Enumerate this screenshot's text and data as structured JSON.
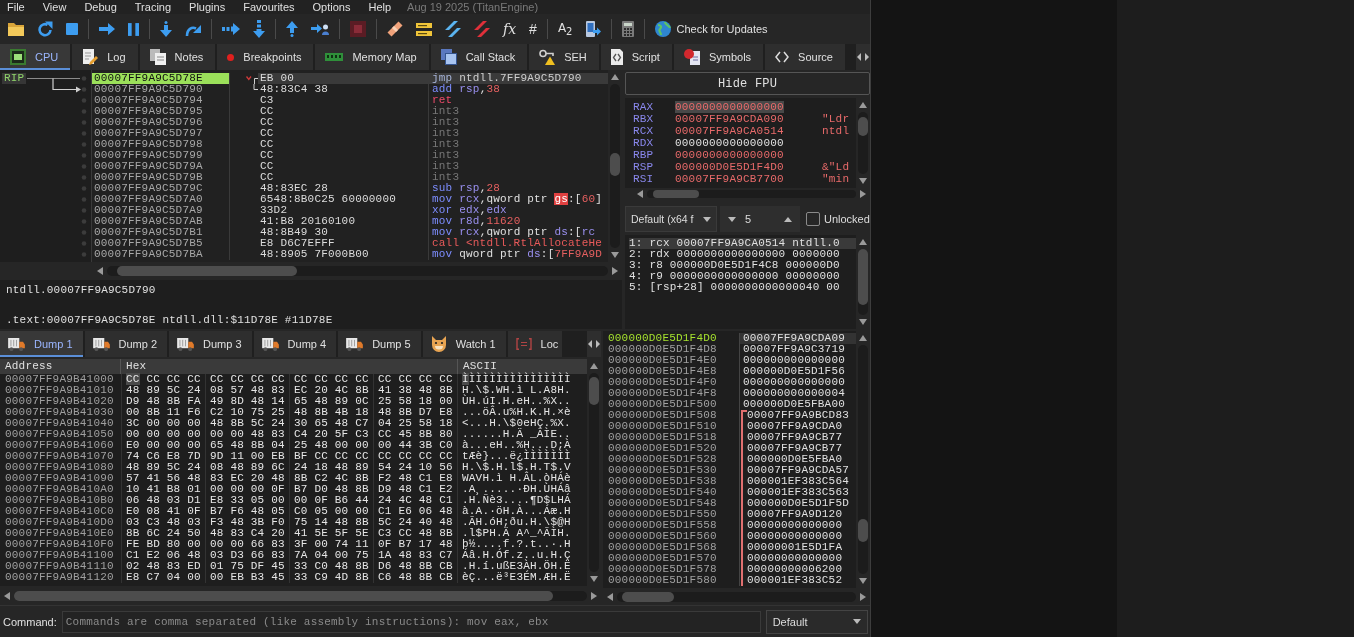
{
  "menu": [
    "File",
    "View",
    "Debug",
    "Tracing",
    "Plugins",
    "Favourites",
    "Options",
    "Help"
  ],
  "build_info": "Aug 19 2025 (TitanEngine)",
  "toolbar": {
    "glyphs": [
      "fx",
      "#",
      "A$_{2}$"
    ],
    "update_button": "Check for Updates"
  },
  "tabs": [
    {
      "label": "CPU",
      "selected": true
    },
    {
      "label": "Log",
      "selected": false
    },
    {
      "label": "Notes",
      "selected": false
    },
    {
      "label": "Breakpoints",
      "selected": false
    },
    {
      "label": "Memory Map",
      "selected": false
    },
    {
      "label": "Call Stack",
      "selected": false
    },
    {
      "label": "SEH",
      "selected": false
    },
    {
      "label": "Script",
      "selected": false
    },
    {
      "label": "Symbols",
      "selected": false
    },
    {
      "label": "Source",
      "selected": false
    }
  ],
  "disassembly": {
    "rip_label": "RIP",
    "rows": [
      {
        "address": "00007FF9A9C5D78E",
        "bytes": "EB 00",
        "mnemonic": "jmp",
        "kind": "jump",
        "operands": [
          {
            "text": "ntdll.7FF9A9C5D790",
            "kind": "symbol"
          }
        ],
        "selected": true,
        "jump_target": false
      },
      {
        "address": "00007FF9A9C5D790",
        "bytes": "48:83C4 38",
        "mnemonic": "add",
        "kind": "arith",
        "operands": [
          {
            "text": "rsp",
            "kind": "register"
          },
          {
            "text": ",",
            "kind": "plain"
          },
          {
            "text": "38",
            "kind": "number"
          }
        ],
        "selected": false,
        "jump_target": true
      },
      {
        "address": "00007FF9A9C5D794",
        "bytes": "C3",
        "mnemonic": "ret",
        "kind": "return",
        "selected": false,
        "jump_target": false
      },
      {
        "address": "00007FF9A9C5D795",
        "bytes": "CC",
        "mnemonic": "int3",
        "kind": "padding",
        "selected": false,
        "jump_target": false
      },
      {
        "address": "00007FF9A9C5D796",
        "bytes": "CC",
        "mnemonic": "int3",
        "kind": "padding",
        "selected": false,
        "jump_target": false
      },
      {
        "address": "00007FF9A9C5D797",
        "bytes": "CC",
        "mnemonic": "int3",
        "kind": "padding",
        "selected": false,
        "jump_target": false
      },
      {
        "address": "00007FF9A9C5D798",
        "bytes": "CC",
        "mnemonic": "int3",
        "kind": "padding",
        "selected": false,
        "jump_target": false
      },
      {
        "address": "00007FF9A9C5D799",
        "bytes": "CC",
        "mnemonic": "int3",
        "kind": "padding",
        "selected": false,
        "jump_target": false
      },
      {
        "address": "00007FF9A9C5D79A",
        "bytes": "CC",
        "mnemonic": "int3",
        "kind": "padding",
        "selected": false,
        "jump_target": false
      },
      {
        "address": "00007FF9A9C5D79B",
        "bytes": "CC",
        "mnemonic": "int3",
        "kind": "padding",
        "selected": false,
        "jump_target": false
      },
      {
        "address": "00007FF9A9C5D79C",
        "bytes": "48:83EC 28",
        "mnemonic": "sub",
        "kind": "arith",
        "operands": [
          {
            "text": "rsp",
            "kind": "register"
          },
          {
            "text": ",",
            "kind": "plain"
          },
          {
            "text": "28",
            "kind": "number"
          }
        ],
        "selected": false,
        "jump_target": false
      },
      {
        "address": "00007FF9A9C5D7A0",
        "bytes": "6548:8B0C25 60000000",
        "mnemonic": "mov",
        "kind": "arith",
        "operands": [
          {
            "text": "rcx",
            "kind": "register"
          },
          {
            "text": ",qword ptr ",
            "kind": "plain"
          },
          {
            "text": "gs",
            "kind": "segment_alert"
          },
          {
            "text": ":[",
            "kind": "plain"
          },
          {
            "text": "60",
            "kind": "number"
          },
          {
            "text": "]",
            "kind": "plain"
          }
        ],
        "selected": false,
        "jump_target": false
      },
      {
        "address": "00007FF9A9C5D7A9",
        "bytes": "33D2",
        "mnemonic": "xor",
        "kind": "arith",
        "operands": [
          {
            "text": "edx",
            "kind": "register"
          },
          {
            "text": ",",
            "kind": "plain"
          },
          {
            "text": "edx",
            "kind": "register"
          }
        ],
        "selected": false,
        "jump_target": false
      },
      {
        "address": "00007FF9A9C5D7AB",
        "bytes": "41:B8 20160100",
        "mnemonic": "mov",
        "kind": "arith",
        "operands": [
          {
            "text": "r8d",
            "kind": "register"
          },
          {
            "text": ",",
            "kind": "plain"
          },
          {
            "text": "11620",
            "kind": "number"
          }
        ],
        "selected": false,
        "jump_target": false
      },
      {
        "address": "00007FF9A9C5D7B1",
        "bytes": "48:8B49 30",
        "mnemonic": "mov",
        "kind": "arith",
        "operands": [
          {
            "text": "rcx",
            "kind": "register"
          },
          {
            "text": ",qword ptr ",
            "kind": "plain"
          },
          {
            "text": "ds",
            "kind": "segment"
          },
          {
            "text": ":[",
            "kind": "plain"
          },
          {
            "text": "rc",
            "kind": "register"
          }
        ],
        "selected": false,
        "jump_target": false
      },
      {
        "address": "00007FF9A9C5D7B5",
        "bytes": "E8 D6C7EFFF",
        "mnemonic": "call",
        "kind": "call",
        "operands": [
          {
            "text": "<ntdll.RtlAllocateHe",
            "kind": "call_target"
          }
        ],
        "selected": false,
        "jump_target": false
      },
      {
        "address": "00007FF9A9C5D7BA",
        "bytes": "48:8905 7F000B00",
        "mnemonic": "mov",
        "kind": "arith",
        "operands": [
          {
            "text": "qword ptr ",
            "kind": "plain"
          },
          {
            "text": "ds",
            "kind": "segment"
          },
          {
            "text": ":[",
            "kind": "plain"
          },
          {
            "text": "7FF9A9D",
            "kind": "number"
          }
        ],
        "selected": false,
        "jump_target": false
      }
    ]
  },
  "info": {
    "lines": [
      "ntdll.00007FF9A9C5D790",
      ".text:00007FF9A9C5D78E ntdll.dll:$11D78E #11D78E"
    ]
  },
  "registers": {
    "button": "Hide FPU",
    "rows": [
      {
        "name": "RAX",
        "value": "0000000000000000",
        "changed": true,
        "selected": true
      },
      {
        "name": "RBX",
        "value": "00007FF9A9CDA090",
        "comment": "\"Ldr",
        "changed": true,
        "selected": false
      },
      {
        "name": "RCX",
        "value": "00007FF9A9CA0514",
        "comment": "ntdl",
        "changed": true,
        "selected": false
      },
      {
        "name": "RDX",
        "value": "0000000000000000",
        "changed": false,
        "selected": false
      },
      {
        "name": "RBP",
        "value": "0000000000000000",
        "changed": true,
        "selected": false
      },
      {
        "name": "RSP",
        "value": "000000D0E5D1F4D0",
        "comment": "&\"Ld",
        "changed": true,
        "selected": false
      },
      {
        "name": "RSI",
        "value": "00007FF9A9CB7700",
        "comment": "\"min",
        "changed": true,
        "selected": false
      }
    ]
  },
  "arguments": {
    "convention": "Default (x64 f",
    "count": "5",
    "unlocked": {
      "label": "Unlocked",
      "checked": false
    },
    "rows": [
      {
        "text": "1: rcx 00007FF9A9CA0514 ntdll.0",
        "selected": true
      },
      {
        "text": "2: rdx 0000000000000000 0000000",
        "selected": false
      },
      {
        "text": "3: r8 000000D0E5D1F4C8 000000D0",
        "selected": false
      },
      {
        "text": "4: r9 0000000000000000 00000000",
        "selected": false
      },
      {
        "text": "5: [rsp+28] 0000000000000040 00",
        "selected": false
      }
    ]
  },
  "dump": {
    "tabs": [
      {
        "label": "Dump 1",
        "selected": true
      },
      {
        "label": "Dump 2",
        "selected": false
      },
      {
        "label": "Dump 3",
        "selected": false
      },
      {
        "label": "Dump 4",
        "selected": false
      },
      {
        "label": "Dump 5",
        "selected": false
      },
      {
        "label": "Watch 1",
        "selected": false
      },
      {
        "label": "Loc",
        "selected": false
      }
    ],
    "columns": [
      "Address",
      "Hex",
      "ASCII"
    ],
    "rows": [
      {
        "address": "00007FF9A9B41000",
        "hex": [
          "CC CC CC CC",
          "CC CC CC CC",
          "CC CC CC CC",
          "CC CC CC CC"
        ],
        "ascii": "ÌÌÌÌÌÌÌÌÌÌÌÌÌÌÌÌ",
        "selected": true
      },
      {
        "address": "00007FF9A9B41010",
        "hex": [
          "48 89 5C 24",
          "08 57 48 83",
          "EC 20 4C 8B",
          "41 38 48 8B"
        ],
        "ascii": "H.\\$.WH.ì L.A8H.",
        "selected": false
      },
      {
        "address": "00007FF9A9B41020",
        "hex": [
          "D9 48 8B FA",
          "49 8D 48 14",
          "65 48 89 0C",
          "25 58 18 00"
        ],
        "ascii": "ÙH.úI.H.eH..%X..",
        "selected": false
      },
      {
        "address": "00007FF9A9B41030",
        "hex": [
          "00 8B 11 F6",
          "C2 10 75 25",
          "48 8B 4B 18",
          "48 8B D7 E8"
        ],
        "ascii": "...öÂ.u%H.K.H.×è",
        "selected": false
      },
      {
        "address": "00007FF9A9B41040",
        "hex": [
          "3C 00 00 00",
          "48 8B 5C 24",
          "30 65 48 C7",
          "04 25 58 18"
        ],
        "ascii": "<...H.\\$0eHÇ.%X.",
        "selected": false
      },
      {
        "address": "00007FF9A9B41050",
        "hex": [
          "00 00 00 00",
          "00 00 48 83",
          "C4 20 5F C3",
          "CC 45 8B 80"
        ],
        "ascii": "......H.Ä _ÃÌE..",
        "selected": false
      },
      {
        "address": "00007FF9A9B41060",
        "hex": [
          "E0 00 00 00",
          "65 48 8B 04",
          "25 48 00 00",
          "00 44 3B C0"
        ],
        "ascii": "à...eH..%H...D;À",
        "selected": false
      },
      {
        "address": "00007FF9A9B41070",
        "hex": [
          "74 C6 E8 7D",
          "9D 11 00 EB",
          "BF CC CC CC",
          "CC CC CC CC"
        ],
        "ascii": "tÆè}...ë¿ÌÌÌÌÌÌÌ",
        "selected": false
      },
      {
        "address": "00007FF9A9B41080",
        "hex": [
          "48 89 5C 24",
          "08 48 89 6C",
          "24 18 48 89",
          "54 24 10 56"
        ],
        "ascii": "H.\\$.H.l$.H.T$.V",
        "selected": false
      },
      {
        "address": "00007FF9A9B41090",
        "hex": [
          "57 41 56 48",
          "83 EC 20 48",
          "8B C2 4C 8B",
          "F2 48 C1 E8"
        ],
        "ascii": "WAVH.ì H.ÂL.òHÁè",
        "selected": false
      },
      {
        "address": "00007FF9A9B410A0",
        "hex": [
          "10 41 B8 01",
          "00 00 00 0F",
          "B7 D0 48 8B",
          "D9 48 C1 E2"
        ],
        "ascii": ".A¸.....·ÐH.ÙHÁâ",
        "selected": false
      },
      {
        "address": "00007FF9A9B410B0",
        "hex": [
          "06 48 03 D1",
          "E8 33 05 00",
          "00 0F B6 44",
          "24 4C 48 C1"
        ],
        "ascii": ".H.Ñè3....¶D$LHÁ",
        "selected": false
      },
      {
        "address": "00007FF9A9B410C0",
        "hex": [
          "E0 08 41 0F",
          "B7 F6 48 05",
          "C0 05 00 00",
          "C1 E6 06 48"
        ],
        "ascii": "à.A.·öH.À...Áæ.H",
        "selected": false
      },
      {
        "address": "00007FF9A9B410D0",
        "hex": [
          "03 C3 48 03",
          "F3 48 3B F0",
          "75 14 48 8B",
          "5C 24 40 48"
        ],
        "ascii": ".ÃH.óH;ðu.H.\\$@H",
        "selected": false
      },
      {
        "address": "00007FF9A9B410E0",
        "hex": [
          "8B 6C 24 50",
          "48 83 C4 20",
          "41 5E 5F 5E",
          "C3 CC 48 8B"
        ],
        "ascii": ".l$PH.Ä A^_^ÃÌH.",
        "selected": false
      },
      {
        "address": "00007FF9A9B410F0",
        "hex": [
          "FE BD 80 00",
          "00 00 66 83",
          "3F 00 74 11",
          "0F B7 17 48"
        ],
        "ascii": "þ½....f.?.t..·.H",
        "selected": false
      },
      {
        "address": "00007FF9A9B41100",
        "hex": [
          "C1 E2 06 48",
          "03 D3 66 83",
          "7A 04 00 75",
          "1A 48 83 C7"
        ],
        "ascii": "Áâ.H.Óf.z..u.H.Ç",
        "selected": false
      },
      {
        "address": "00007FF9A9B41110",
        "hex": [
          "02 48 83 ED",
          "01 75 DF 45",
          "33 C0 48 8B",
          "D6 48 8B CB"
        ],
        "ascii": ".H.í.ußE3ÀH.ÖH.Ë",
        "selected": false
      },
      {
        "address": "00007FF9A9B41120",
        "hex": [
          "E8 C7 04 00",
          "00 EB B3 45",
          "33 C9 4D 8B",
          "C6 48 8B CB"
        ],
        "ascii": "èÇ...ë³E3ÉM.ÆH.Ë",
        "selected": false
      }
    ]
  },
  "stack": {
    "rows": [
      {
        "address": "000000D0E5D1F4D0",
        "value": "00007FF9A9CDA09",
        "selected": true,
        "in_frame": false
      },
      {
        "address": "000000D0E5D1F4D8",
        "value": "00007FF9A9C3719",
        "selected": false,
        "in_frame": false
      },
      {
        "address": "000000D0E5D1F4E0",
        "value": "000000000000000",
        "selected": false,
        "in_frame": false
      },
      {
        "address": "000000D0E5D1F4E8",
        "value": "000000D0E5D1F56",
        "selected": false,
        "in_frame": false
      },
      {
        "address": "000000D0E5D1F4F0",
        "value": "000000000000000",
        "selected": false,
        "in_frame": false
      },
      {
        "address": "000000D0E5D1F4F8",
        "value": "000000000000004",
        "selected": false,
        "in_frame": false
      },
      {
        "address": "000000D0E5D1F500",
        "value": "000000D0E5FBA00",
        "selected": false,
        "in_frame": false
      },
      {
        "address": "000000D0E5D1F508",
        "value": "00007FF9A9BCD83",
        "selected": false,
        "in_frame": true
      },
      {
        "address": "000000D0E5D1F510",
        "value": "00007FF9A9CDA0",
        "selected": false,
        "in_frame": true
      },
      {
        "address": "000000D0E5D1F518",
        "value": "00007FF9A9CB77",
        "selected": false,
        "in_frame": true
      },
      {
        "address": "000000D0E5D1F520",
        "value": "00007FF9A9CB77",
        "selected": false,
        "in_frame": true
      },
      {
        "address": "000000D0E5D1F528",
        "value": "000000D0E5FBA0",
        "selected": false,
        "in_frame": true
      },
      {
        "address": "000000D0E5D1F530",
        "value": "00007FF9A9CDA57",
        "selected": false,
        "in_frame": true
      },
      {
        "address": "000000D0E5D1F538",
        "value": "000001EF383C564",
        "selected": false,
        "in_frame": true
      },
      {
        "address": "000000D0E5D1F540",
        "value": "000001EF383C563",
        "selected": false,
        "in_frame": true
      },
      {
        "address": "000000D0E5D1F548",
        "value": "000000D0E5D1F5D",
        "selected": false,
        "in_frame": true
      },
      {
        "address": "000000D0E5D1F550",
        "value": "00007FF9A9D120",
        "selected": false,
        "in_frame": true
      },
      {
        "address": "000000D0E5D1F558",
        "value": "00000000000000",
        "selected": false,
        "in_frame": true
      },
      {
        "address": "000000D0E5D1F560",
        "value": "00000000000000",
        "selected": false,
        "in_frame": true
      },
      {
        "address": "000000D0E5D1F568",
        "value": "00000001E5D1FA",
        "selected": false,
        "in_frame": true
      },
      {
        "address": "000000D0E5D1F570",
        "value": "00000000000000",
        "selected": false,
        "in_frame": true
      },
      {
        "address": "000000D0E5D1F578",
        "value": "00000000006200",
        "selected": false,
        "in_frame": true
      },
      {
        "address": "000000D0E5D1F580",
        "value": "000001EF383C52",
        "selected": false,
        "in_frame": true
      }
    ]
  },
  "command": {
    "label": "Command:",
    "placeholder": "Commands are comma separated (like assembly instructions): mov eax, ebx",
    "mode": "Default"
  }
}
